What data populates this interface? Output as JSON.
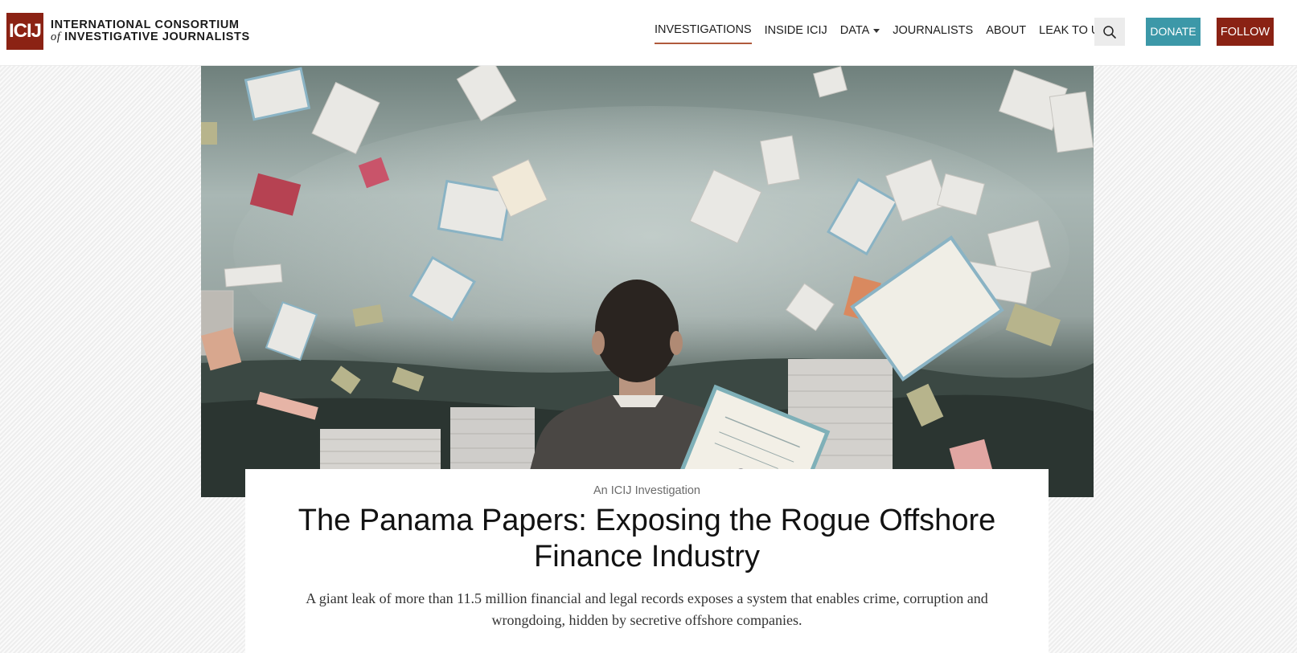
{
  "logo": {
    "mark": "ICIJ",
    "line1": "INTERNATIONAL CONSORTIUM",
    "line2_of": "of",
    "line2_rest": "INVESTIGATIVE JOURNALISTS"
  },
  "nav": {
    "items": [
      {
        "label": "INVESTIGATIONS",
        "active": true
      },
      {
        "label": "INSIDE ICIJ"
      },
      {
        "label": "DATA",
        "dropdown": true
      },
      {
        "label": "JOURNALISTS"
      },
      {
        "label": "ABOUT"
      },
      {
        "label": "LEAK TO US"
      }
    ],
    "search_icon": "search-icon",
    "donate_label": "DONATE",
    "follow_label": "FOLLOW"
  },
  "colors": {
    "brand_red": "#8b2214",
    "donate_teal": "#3c98a8",
    "active_underline": "#b05a3c"
  },
  "article": {
    "kicker": "An ICIJ Investigation",
    "title": "The Panama Papers: Exposing the Rogue Offshore Finance Industry",
    "dek": "A giant leak of more than 11.5 million financial and legal records exposes a system that enables crime, corruption and wrongdoing, hidden by secretive offshore companies."
  }
}
